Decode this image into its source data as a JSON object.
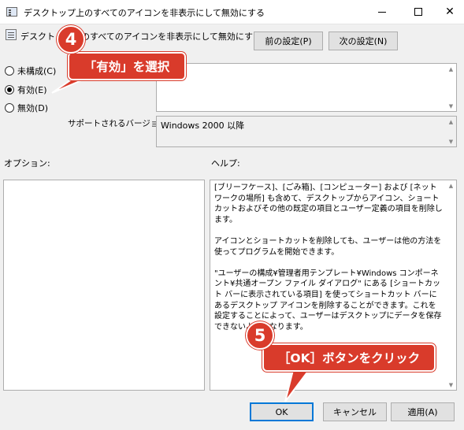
{
  "window": {
    "title": "デスクトップ上のすべてのアイコンを非表示にして無効にする",
    "minimize_icon": "minimize-icon",
    "maximize_icon": "maximize-icon",
    "close_symbol": "✕"
  },
  "header": {
    "setting_title": "デスクトップ上のすべてのアイコンを非表示にして無効にする",
    "prev_button": "前の設定(P)",
    "next_button": "次の設定(N)"
  },
  "state": {
    "options": [
      {
        "label": "未構成(C)",
        "selected": false
      },
      {
        "label": "有効(E)",
        "selected": true
      },
      {
        "label": "無効(D)",
        "selected": false
      }
    ]
  },
  "comment": {
    "value": ""
  },
  "supported": {
    "label": "サポートされるバージョン:",
    "value": "Windows 2000 以降"
  },
  "sections": {
    "options_label": "オプション:",
    "help_label": "ヘルプ:"
  },
  "help_text": "[ブリーフケース]、[ごみ箱]、[コンピューター] および [ネットワークの場所] も含めて、デスクトップからアイコン、ショートカットおよびその他の既定の項目とユーザー定義の項目を削除します。\n\nアイコンとショートカットを削除しても、ユーザーは他の方法を使ってプログラムを開始できます。\n\n\"ユーザーの構成¥管理者用テンプレート¥Windows コンポーネント¥共通オープン ファイル ダイアログ\" にある [ショートカット バーに表示されている項目] を使ってショートカット バーにあるデスクトップ アイコンを削除することができます。これを設定することによって、ユーザーはデスクトップにデータを保存できないようになります。",
  "footer": {
    "ok": "OK",
    "cancel": "キャンセル",
    "apply": "適用(A)"
  },
  "annotations": {
    "step4_number": "4",
    "step4_text": "「有効」を選択",
    "step5_number": "5",
    "step5_text": "［OK］ボタンをクリック",
    "color": "#d93b2b"
  }
}
